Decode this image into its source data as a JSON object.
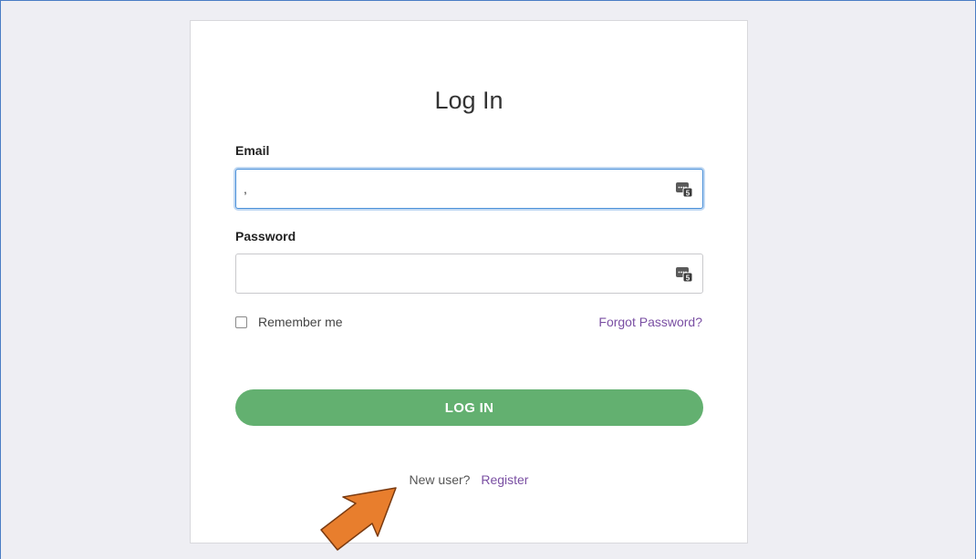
{
  "login": {
    "title": "Log In",
    "email_label": "Email",
    "email_value": ",",
    "password_label": "Password",
    "password_value": "",
    "remember_label": "Remember me",
    "forgot_label": "Forgot Password?",
    "button_label": "LOG IN",
    "new_user_text": "New user?",
    "register_label": "Register"
  },
  "icons": {
    "password_manager": "password-manager-icon",
    "annotation": "orange-arrow"
  },
  "colors": {
    "primary_button": "#63b070",
    "link": "#7a4fa3",
    "focus_border": "#4a90d9",
    "arrow": "#e87e2d",
    "background": "#eeeef3"
  }
}
